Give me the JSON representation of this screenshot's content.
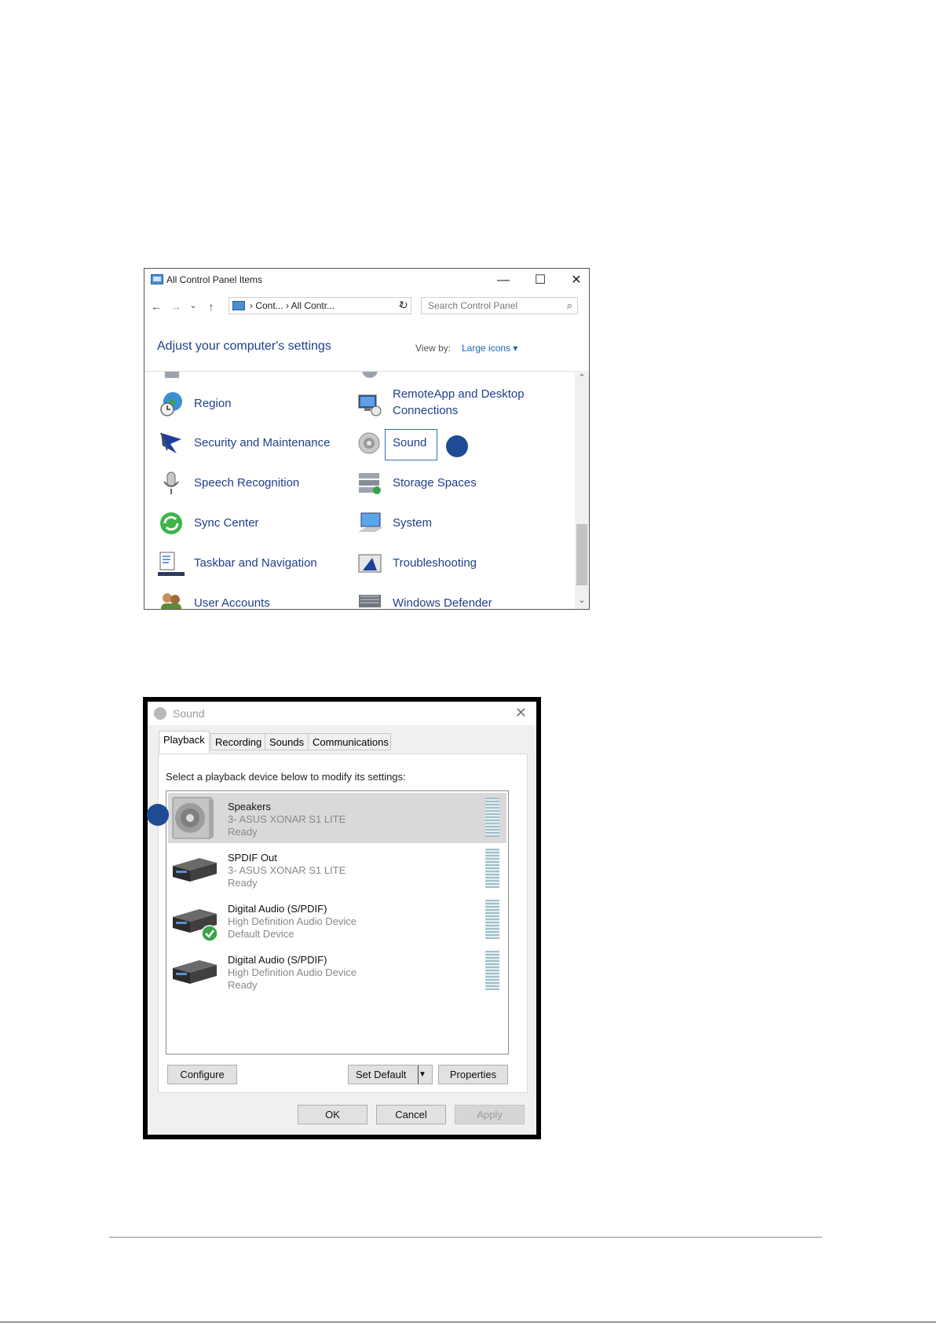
{
  "control_panel": {
    "title": "All Control Panel Items",
    "window_buttons": {
      "minimize": "—",
      "maximize": "☐",
      "close": "✕"
    },
    "nav": {
      "back": "←",
      "forward": "→",
      "recent": "⌄",
      "up": "↑"
    },
    "breadcrumb": "› Cont...  › All Contr...",
    "breadcrumb_dropdown": "⌄",
    "refresh": "↻",
    "search_placeholder": "Search Control Panel",
    "search_icon": "⌕",
    "heading": "Adjust your computer's settings",
    "view_by_label": "View by:",
    "view_by_value": "Large icons ▾",
    "items": [
      {
        "label": "Region",
        "icon": "globe-clock-icon"
      },
      {
        "label": "RemoteApp and Desktop Connections",
        "line1": "RemoteApp and Desktop",
        "line2": "Connections",
        "icon": "remote-desktop-icon"
      },
      {
        "label": "Security and Maintenance",
        "icon": "flag-icon"
      },
      {
        "label": "Sound",
        "icon": "speaker-icon"
      },
      {
        "label": "Speech Recognition",
        "icon": "microphone-icon"
      },
      {
        "label": "Storage Spaces",
        "icon": "storage-icon"
      },
      {
        "label": "Sync Center",
        "icon": "sync-icon"
      },
      {
        "label": "System",
        "icon": "computer-icon"
      },
      {
        "label": "Taskbar and Navigation",
        "icon": "taskbar-icon"
      },
      {
        "label": "Troubleshooting",
        "icon": "troubleshoot-icon"
      },
      {
        "label": "User Accounts",
        "icon": "users-icon"
      },
      {
        "label": "Windows Defender",
        "icon": "defender-icon"
      }
    ],
    "scroll_up": "⌃",
    "scroll_down": "⌄"
  },
  "sound_dialog": {
    "title": "Sound",
    "close": "✕",
    "tabs": [
      "Playback",
      "Recording",
      "Sounds",
      "Communications"
    ],
    "active_tab": "Playback",
    "instruction": "Select a playback device below to modify its settings:",
    "devices": [
      {
        "name": "Speakers",
        "device": "3- ASUS XONAR S1 LITE",
        "status": "Ready",
        "selected": true,
        "icon": "speakers-icon"
      },
      {
        "name": "SPDIF Out",
        "device": "3- ASUS XONAR S1 LITE",
        "status": "Ready",
        "selected": false,
        "icon": "spdif-device-icon"
      },
      {
        "name": "Digital Audio (S/PDIF)",
        "device": "High Definition Audio Device",
        "status": "Default Device",
        "selected": false,
        "default": true,
        "icon": "spdif-device-icon"
      },
      {
        "name": "Digital Audio (S/PDIF)",
        "device": "High Definition Audio Device",
        "status": "Ready",
        "selected": false,
        "icon": "spdif-device-icon"
      }
    ],
    "buttons": {
      "configure": "Configure",
      "set_default": "Set Default",
      "set_default_arrow": "▼",
      "properties": "Properties",
      "ok": "OK",
      "cancel": "Cancel",
      "apply": "Apply"
    }
  },
  "colors": {
    "link_blue": "#1e3f8a",
    "marker_blue": "#1e4b94",
    "selection_gray": "#d9d9d9"
  }
}
